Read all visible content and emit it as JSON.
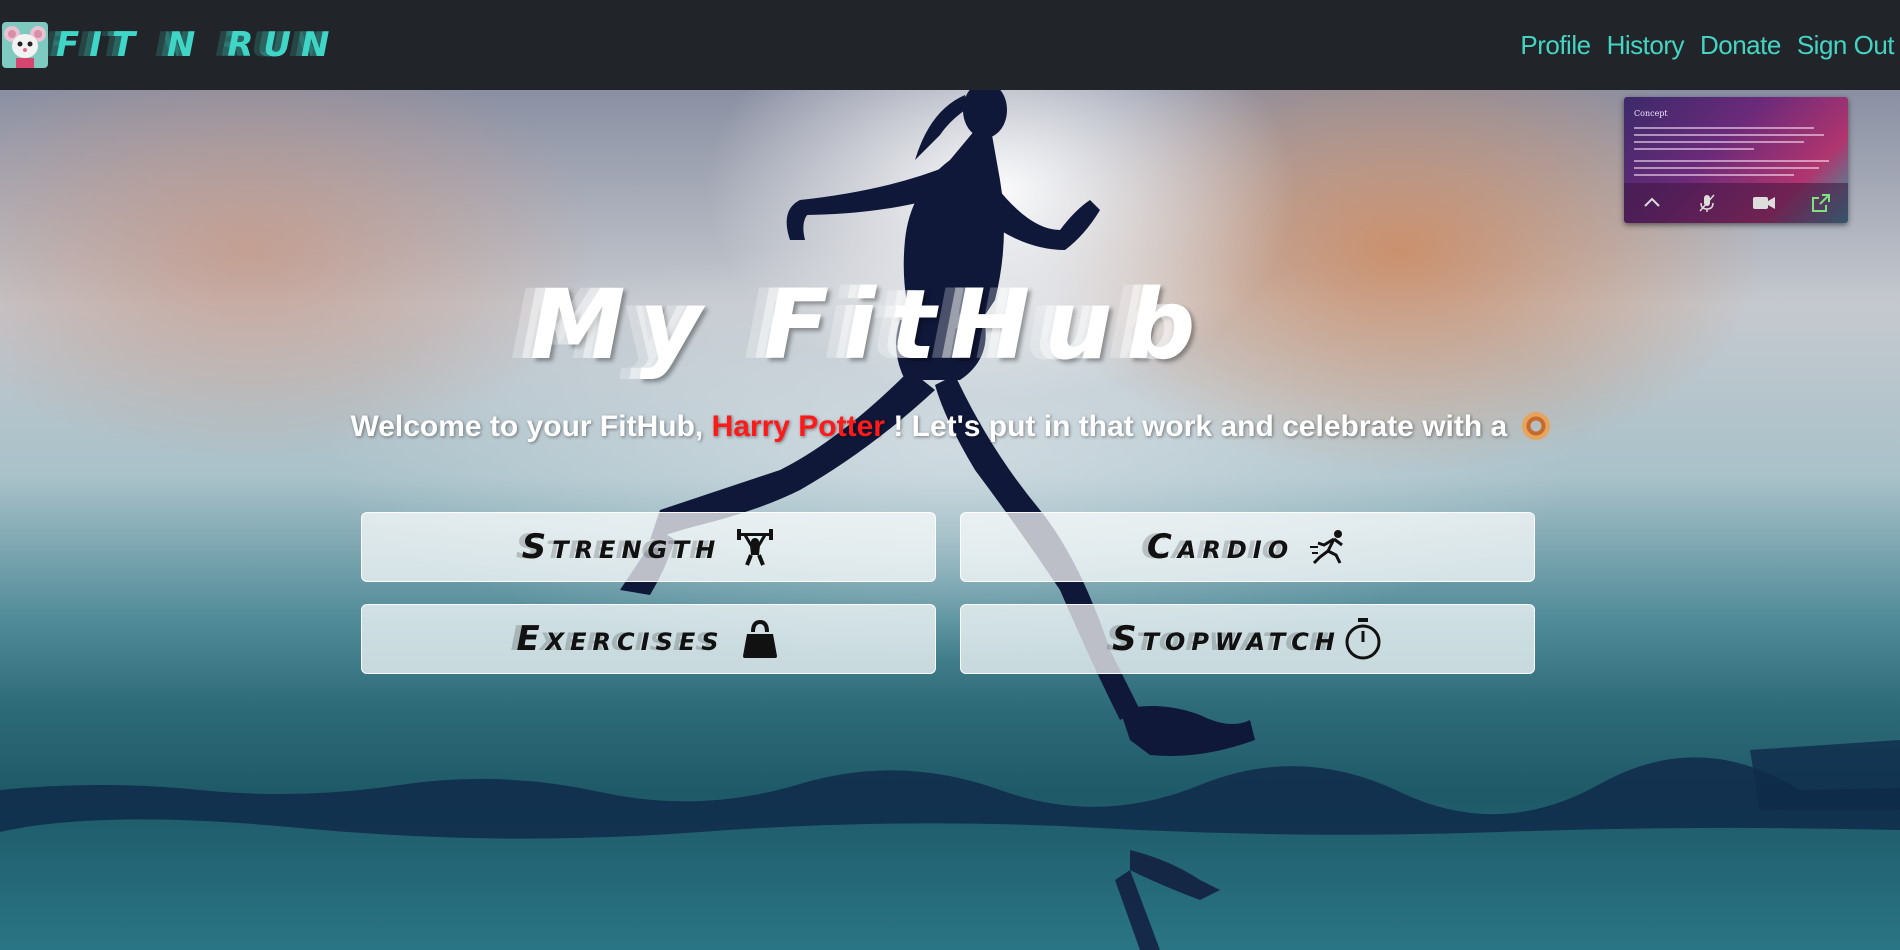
{
  "navbar": {
    "brand_text": "FIT N RUN",
    "links": [
      "Profile",
      "History",
      "Donate",
      "Sign Out"
    ]
  },
  "main": {
    "title": "My FitHub",
    "welcome_prefix": "Welcome to your FitHub, ",
    "user_name": "Harry Potter",
    "welcome_suffix": " ! Let's put in that work and celebrate with a",
    "buttons": {
      "strength": "Strength",
      "cardio": "Cardio",
      "exercises": "Exercises",
      "stopwatch": "Stopwatch"
    }
  },
  "pip": {
    "doc_title": "Concept"
  },
  "colors": {
    "navbar_bg": "#212529",
    "nav_accent": "#45d4c4",
    "user_name": "#ff1a1a"
  },
  "icons": {
    "brand": "mouse-mascot-icon",
    "strength": "weightlifter-icon",
    "cardio": "runner-icon",
    "exercises": "kettlebell-icon",
    "stopwatch": "stopwatch-icon",
    "treat": "donut-icon"
  }
}
